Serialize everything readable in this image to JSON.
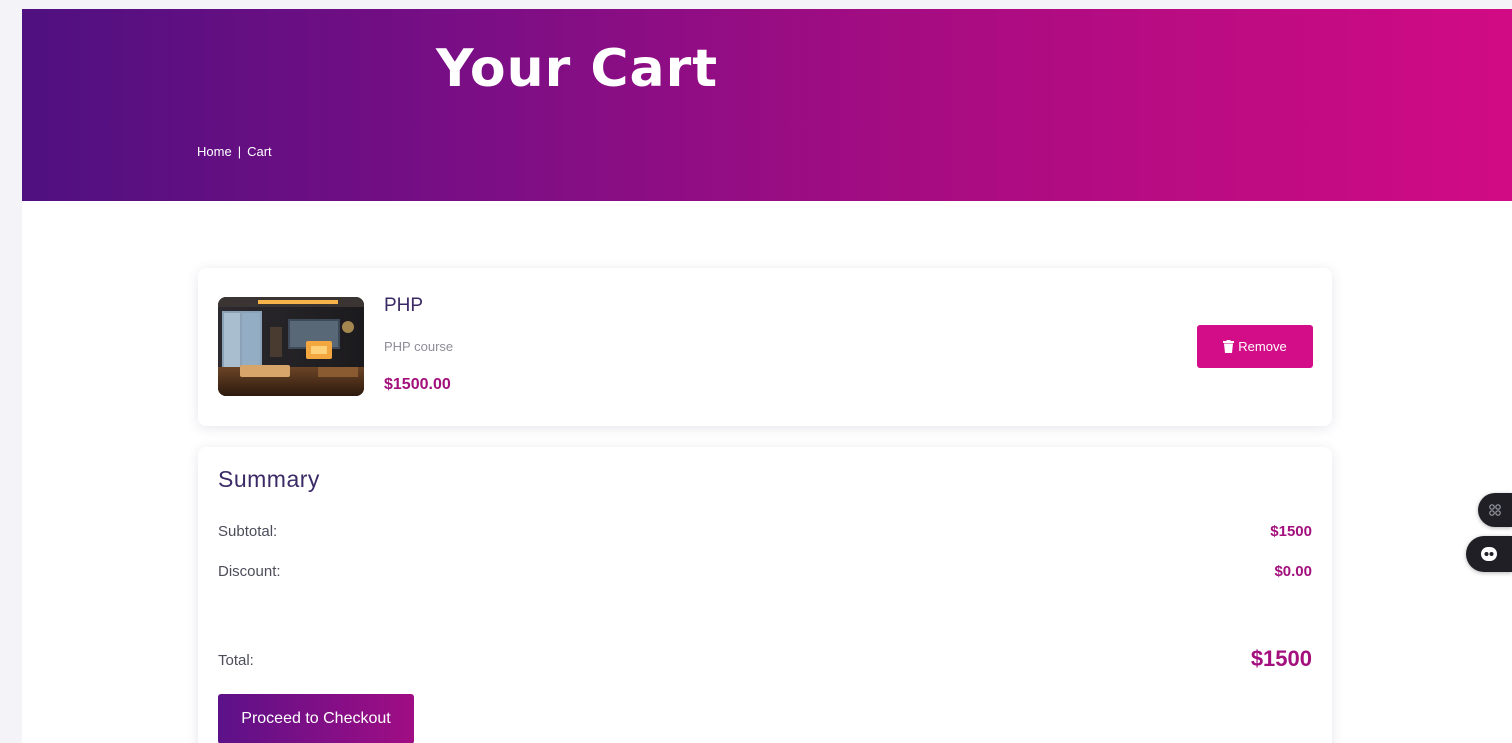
{
  "hero": {
    "title": "Your Cart",
    "breadcrumb": {
      "home": "Home",
      "separator": "|",
      "current": "Cart"
    }
  },
  "cart": {
    "items": [
      {
        "name": "PHP",
        "description": "PHP course",
        "price": "$1500.00",
        "remove_label": "Remove"
      }
    ]
  },
  "summary": {
    "title": "Summary",
    "subtotal_label": "Subtotal:",
    "subtotal_value": "$1500",
    "discount_label": "Discount:",
    "discount_value": "$0.00",
    "total_label": "Total:",
    "total_value": "$1500",
    "checkout_label": "Proceed to Checkout"
  },
  "colors": {
    "gradient_start": "#4f1080",
    "gradient_end": "#d10b84",
    "accent": "#d20d87",
    "price": "#a30f7c",
    "heading": "#3b2a66"
  },
  "icons": {
    "remove": "trash-icon",
    "floating_top": "grid-icon",
    "floating_bottom": "chat-bot-icon"
  }
}
